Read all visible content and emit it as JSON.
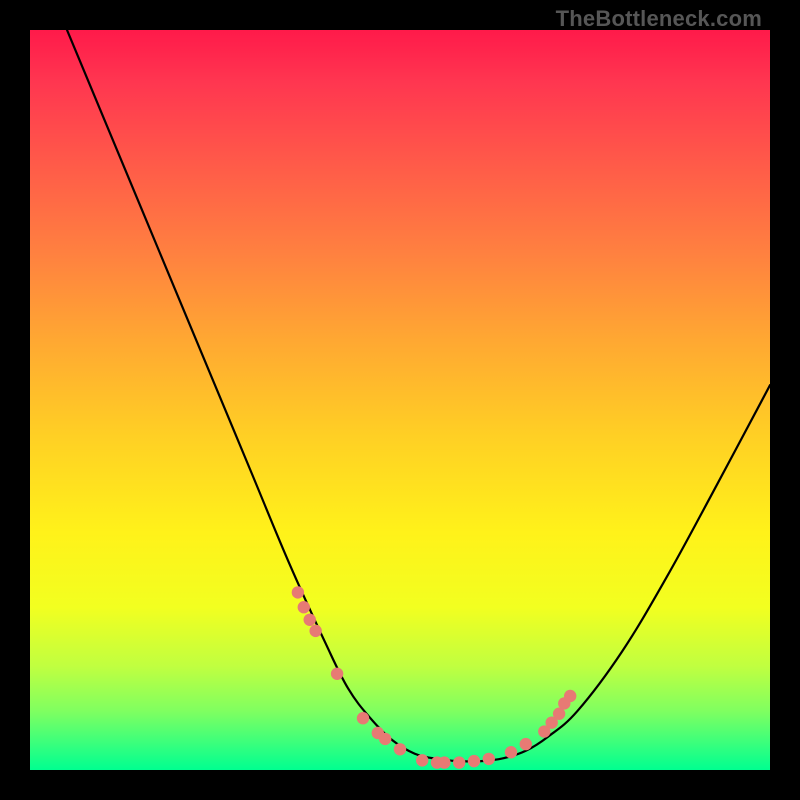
{
  "watermark": "TheBottleneck.com",
  "colors": {
    "background": "#000000",
    "gradient_top": "#ff1a4a",
    "gradient_bottom": "#00ff90",
    "curve": "#000000",
    "dot": "#e77a74"
  },
  "chart_data": {
    "type": "line",
    "title": "",
    "xlabel": "",
    "ylabel": "",
    "xlim": [
      0,
      100
    ],
    "ylim": [
      0,
      100
    ],
    "grid": false,
    "legend": false,
    "annotations": [],
    "series": [
      {
        "name": "curve",
        "x": [
          5,
          10,
          15,
          20,
          25,
          30,
          35,
          40,
          43,
          46,
          49,
          52,
          55,
          58,
          61,
          64,
          67,
          70,
          74,
          80,
          86,
          92,
          100
        ],
        "values": [
          100,
          88,
          76,
          64,
          52,
          40,
          28,
          17,
          11,
          7,
          4,
          2.2,
          1.5,
          1.2,
          1.2,
          1.6,
          2.6,
          4.5,
          8,
          16,
          26,
          37,
          52
        ]
      }
    ],
    "markers": [
      {
        "name": "dots",
        "x": [
          36.2,
          37.0,
          37.8,
          38.6,
          41.5,
          45.0,
          47.0,
          48.0,
          50.0,
          53.0,
          55.0,
          56.0,
          58.0,
          60.0,
          62.0,
          65.0,
          67.0,
          69.5,
          70.5,
          71.5,
          72.2,
          73.0
        ],
        "values": [
          24.0,
          22.0,
          20.3,
          18.8,
          13.0,
          7.0,
          5.0,
          4.2,
          2.8,
          1.3,
          1.0,
          1.0,
          1.0,
          1.2,
          1.5,
          2.4,
          3.5,
          5.2,
          6.4,
          7.6,
          9.0,
          10.0
        ]
      }
    ]
  }
}
